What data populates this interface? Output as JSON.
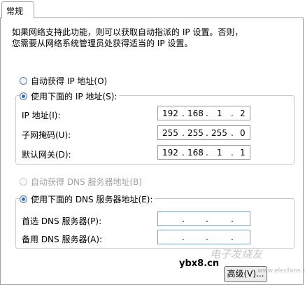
{
  "tab": {
    "label": "常规"
  },
  "description": {
    "line1": "如果网络支持此功能，则可以获取自动指派的 IP 设置。否则，",
    "line2": "您需要从网络系统管理员处获得适当的 IP 设置。"
  },
  "ip": {
    "auto_label": "自动获得 IP 地址(O)",
    "auto_selected": false,
    "manual_label": "使用下面的 IP 地址(S):",
    "manual_selected": true,
    "fields": [
      {
        "label": "IP 地址(I):",
        "octets": [
          "192",
          "168",
          "1",
          "2"
        ]
      },
      {
        "label": "子网掩码(U):",
        "octets": [
          "255",
          "255",
          "255",
          "0"
        ]
      },
      {
        "label": "默认网关(D):",
        "octets": [
          "192",
          "168",
          "1",
          "1"
        ]
      }
    ]
  },
  "dns": {
    "auto_label": "自动获得 DNS 服务器地址(B)",
    "auto_selected": false,
    "auto_disabled": true,
    "manual_label": "使用下面的 DNS 服务器地址(E):",
    "manual_selected": true,
    "fields": [
      {
        "label": "首选 DNS 服务器(P):",
        "octets": [
          "",
          "",
          "",
          ""
        ]
      },
      {
        "label": "备用 DNS 服务器(A):",
        "octets": [
          "",
          "",
          "",
          ""
        ]
      }
    ]
  },
  "advanced_button": {
    "label": "高级(V)..."
  },
  "watermark": {
    "site": "ybx8.cn",
    "brand": "电子发烧友",
    "url": "www.elecfans.com"
  },
  "colors": {
    "radio_dot": "#2a6fcf",
    "border": "#9aa0a6",
    "input_border": "#7f9db9"
  }
}
